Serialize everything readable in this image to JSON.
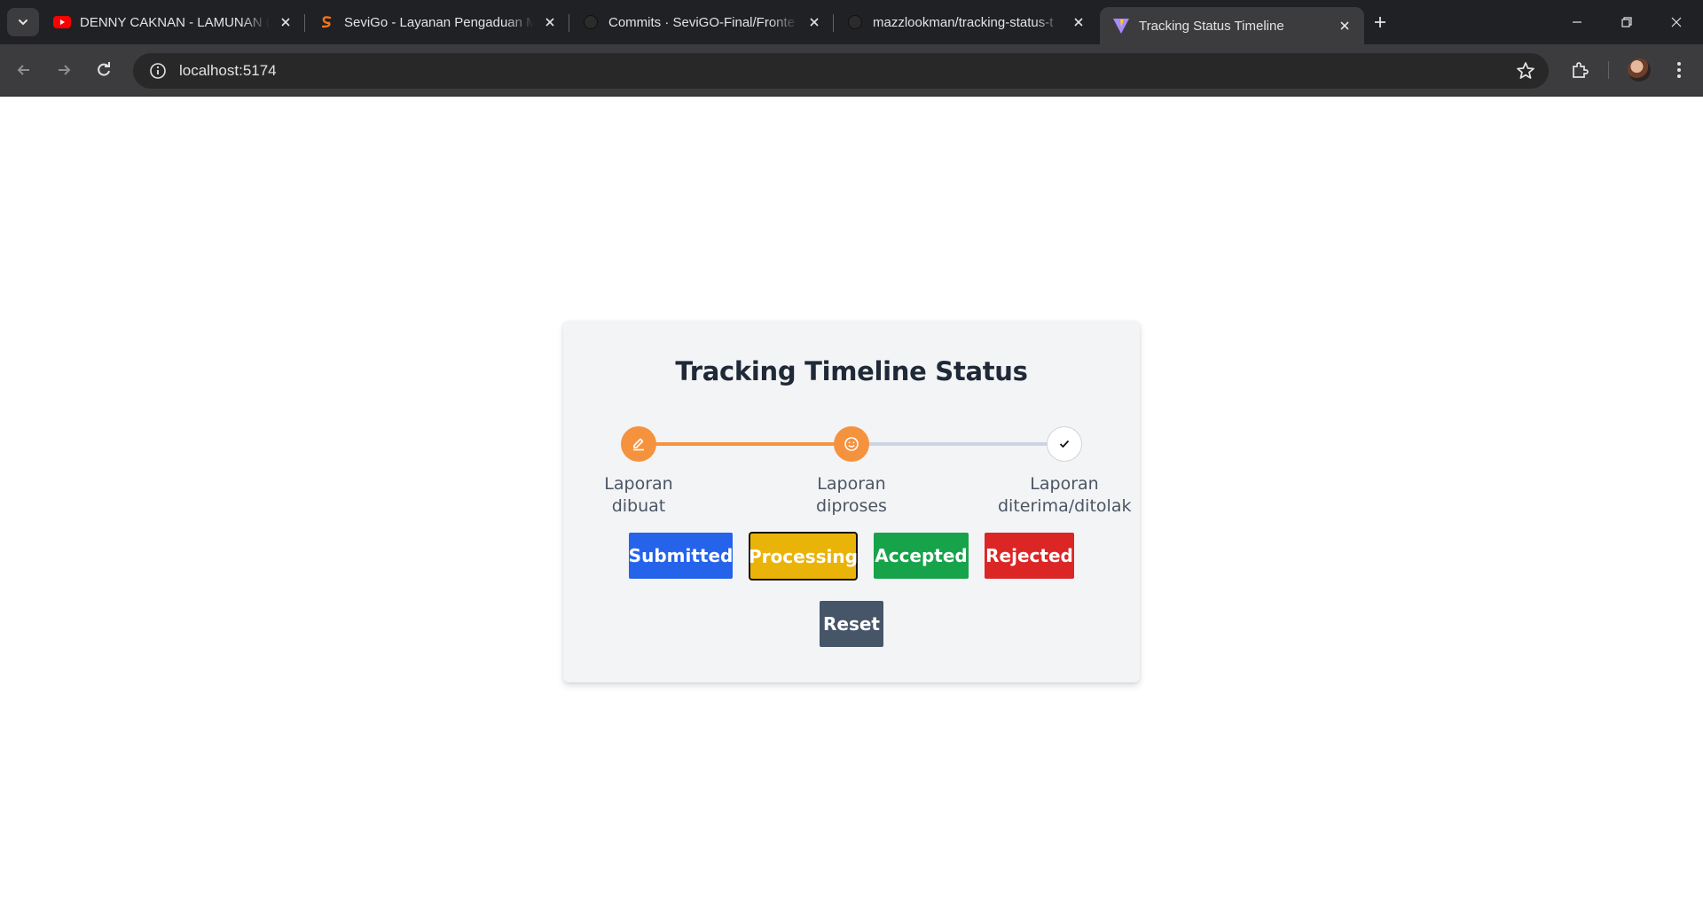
{
  "browser": {
    "tabs": [
      {
        "title": "DENNY CAKNAN - LAMUNAN (",
        "icon": "youtube-icon"
      },
      {
        "title": "SeviGo - Layanan Pengaduan M",
        "icon": "sevigo-icon"
      },
      {
        "title": "Commits · SeviGO-Final/Fronte",
        "icon": "github-icon"
      },
      {
        "title": "mazzlookman/tracking-status-t",
        "icon": "github-icon"
      },
      {
        "title": "Tracking Status Timeline",
        "icon": "vite-icon",
        "active": true
      }
    ],
    "url": "localhost:5174"
  },
  "page": {
    "title": "Tracking Timeline Status",
    "steps": [
      {
        "label_line1": "Laporan",
        "label_line2": "dibuat",
        "state": "done",
        "icon": "pencil-icon"
      },
      {
        "label_line1": "Laporan",
        "label_line2": "diproses",
        "state": "done",
        "icon": "smiley-icon"
      },
      {
        "label_line1": "Laporan",
        "label_line2": "diterima/ditolak",
        "state": "pending",
        "icon": "check-icon"
      }
    ],
    "buttons": {
      "submitted": "Submitted",
      "processing": "Processing",
      "accepted": "Accepted",
      "rejected": "Rejected",
      "reset": "Reset"
    },
    "colors": {
      "accent_orange": "#f5923e",
      "submitted": "#2563eb",
      "processing": "#eab308",
      "accepted": "#16a34a",
      "rejected": "#dc2626",
      "reset": "#475569"
    }
  }
}
